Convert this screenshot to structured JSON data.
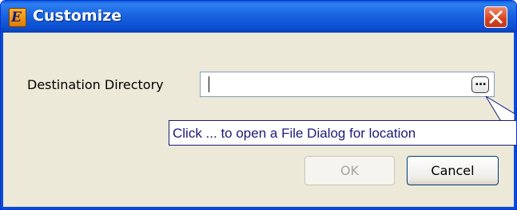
{
  "window": {
    "title": "Customize",
    "app_icon_letter": "E",
    "app_icon_name": "app-e-icon",
    "close_icon_name": "close-icon"
  },
  "form": {
    "destination_label": "Destination Directory",
    "destination_value": "",
    "browse_label": "…"
  },
  "tooltip": {
    "text": "Click ... to open a File Dialog for location"
  },
  "buttons": {
    "ok_label": "OK",
    "ok_enabled": false,
    "cancel_label": "Cancel"
  },
  "colors": {
    "titlebar": "#0a4fd0",
    "dialog_background": "#ece9d8",
    "tooltip_text": "#1b1b7a",
    "close_button": "#d9431f"
  }
}
